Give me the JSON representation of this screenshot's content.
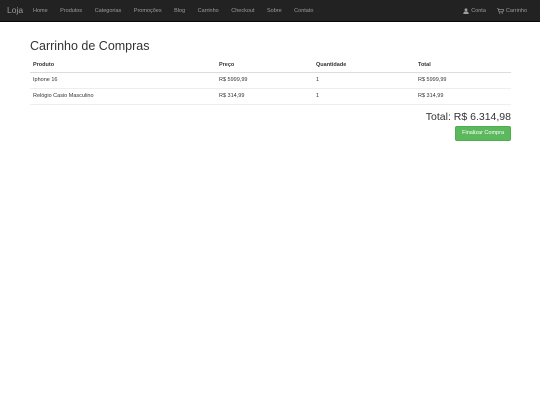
{
  "navbar": {
    "brand": "Loja",
    "links": [
      "Home",
      "Produtos",
      "Categorias",
      "Promoções",
      "Blog",
      "Carrinho",
      "Checkout",
      "Sobre",
      "Contato"
    ],
    "account_label": "Conta",
    "cart_label": "Carrinho",
    "account_icon": "user-icon",
    "cart_icon": "cart-icon"
  },
  "page": {
    "title": "Carrinho de Compras"
  },
  "cart_table": {
    "headers": [
      "Produto",
      "Preço",
      "Quantidade",
      "Total"
    ],
    "rows": [
      [
        "Iphone 16",
        "R$ 5999,99",
        "1",
        "R$ 5999,99"
      ],
      [
        "Relógio Casio Masculino",
        "R$ 314,99",
        "1",
        "R$ 314,99"
      ]
    ]
  },
  "summary": {
    "total": "Total: R$ 6.314,98",
    "checkout_label": "Finalizar Compra",
    "checkout_color": "#5cb85c"
  },
  "colors": {
    "navbar_bg": "#222222",
    "nav_text": "#9d9d9d"
  }
}
